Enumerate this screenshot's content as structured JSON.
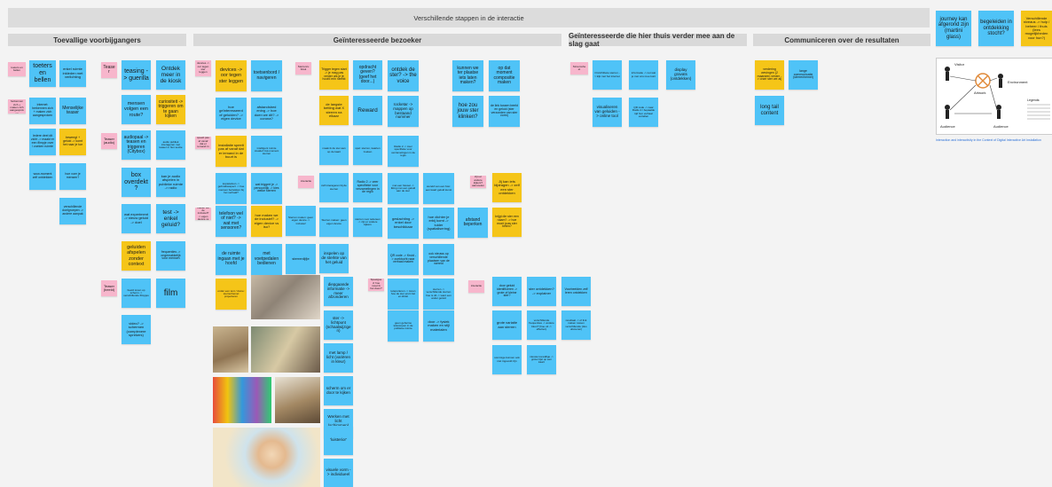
{
  "title_bar": "Verschillende stappen in de interactie",
  "headers": {
    "toevallig": "Toevallige voorbijgangers",
    "geinteresseerd": "Geïnteresseerde bezoeker",
    "thuis": "Geïnteresseerde die hier thuis verder mee aan de slag gaat",
    "communiceren": "Communiceren over de resultaten"
  },
  "notes": [
    {
      "id": "n1",
      "text": "toeters en bellen"
    },
    {
      "id": "n2",
      "text": "enkel ruimte inkleden met verlichting"
    },
    {
      "id": "n3",
      "text": "Teaser"
    },
    {
      "id": "n4",
      "text": "teasing -> guerilla"
    },
    {
      "id": "n5",
      "text": "Ontdek meer in de kiosk"
    },
    {
      "id": "n6",
      "text": "internet: herkennen zich + maken zich aangesproken"
    },
    {
      "id": "n7",
      "text": "Menselijke teaser"
    },
    {
      "id": "n8",
      "text": "mensen volgen een route?"
    },
    {
      "id": "n9",
      "text": "curiositeit -> triggeren om te gaan kijken"
    },
    {
      "id": "n10",
      "text": "Iedere deel dit zicht -> maakt er een filmpje over / zoeken ruimte"
    },
    {
      "id": "n11",
      "text": "beweegt + geluid -> komt het naar je toe"
    },
    {
      "id": "n12",
      "text": "Teaser (audio)"
    },
    {
      "id": "n13",
      "text": "audiopaal -> teasen en triggeren (Citybox)"
    },
    {
      "id": "n14",
      "text": "audio publiek interageren met teaser in hun sectie"
    },
    {
      "id": "n15",
      "text": "wow-moment zelf ontdekken"
    },
    {
      "id": "n16",
      "text": "hoe voer je mensen?"
    },
    {
      "id": "n17",
      "text": "box overdekt?"
    },
    {
      "id": "n18",
      "text": "kan je audio afspelen in publieke ruimte -> radio"
    },
    {
      "id": "n19",
      "text": "verschillende doelgroepen -> andere aanpak"
    },
    {
      "id": "n20",
      "text": "wat experiment -> nieuw geluid -> doel"
    },
    {
      "id": "n21",
      "text": "test -> enkel geluid?"
    },
    {
      "id": "n22",
      "text": "geluiden afspelen zonder context"
    },
    {
      "id": "n23",
      "text": "frequenties -> ongemakkelijk voor mensen"
    },
    {
      "id": "n24",
      "text": "Teaser (beeld)"
    },
    {
      "id": "n25",
      "text": "film"
    },
    {
      "id": "n26",
      "text": "beeld tonen op scherm -> verschillende filmpjes"
    },
    {
      "id": "n27",
      "text": "video? -> schermen (complexere sprekers)"
    },
    {
      "id": "n28",
      "text": "devices -> oor tegen ster leggen"
    },
    {
      "id": "n29",
      "text": "toetsenbord / navigeren"
    },
    {
      "id": "n30",
      "text": "Sterrenrubriek"
    },
    {
      "id": "n31",
      "text": "hoe geïnteresseerd of geluiden? -> eigen device"
    },
    {
      "id": "n32",
      "text": "afstandsbed ening -> hoe doen we dit? -> corona?"
    },
    {
      "id": "n33",
      "text": "installatie speelt pas af vanaf dat er iemand in de buurt is"
    },
    {
      "id": "n34",
      "text": "koptelefoon -> gebruiksaspect -> hoe mensen betrekken bij het verhaal?"
    },
    {
      "id": "n35",
      "text": "wat triggert je -> persoonlijk -> kies welke sterren"
    },
    {
      "id": "n36",
      "text": "telefoon wel of niet? -> wat met sensoren?"
    },
    {
      "id": "n37",
      "text": "hoe maken we de inclusief? -> eigen device vs iso?"
    },
    {
      "id": "n38",
      "text": "Sterren maken: geen eigen device -> inclusief"
    },
    {
      "id": "n39",
      "text": "de ruimte ingaan met je hoofd"
    },
    {
      "id": "n40",
      "text": "met voetpedalen bedienen"
    },
    {
      "id": "n41",
      "text": "sterrenlijfje"
    },
    {
      "id": "n42",
      "text": "onder een tent / dome: sterrenhemel projecteren"
    },
    {
      "id": "n43",
      "text": "Trigger tegen start -> je mag pas verder als je je hoofd erin steekt"
    },
    {
      "id": "n44",
      "text": "opdracht geven? (geef het door...)"
    },
    {
      "id": "n45",
      "text": "ontdek de ster? -> the voice"
    },
    {
      "id": "n46",
      "text": "kunnen we ter plaatse iets laten maken?"
    },
    {
      "id": "n47",
      "text": "op dat moment compositie maken"
    },
    {
      "id": "n48",
      "text": "de langste betting wat X sterren na elkaar"
    },
    {
      "id": "n49",
      "text": "Reward"
    },
    {
      "id": "n50",
      "text": "rocketar -> mappen op bestaand nummer"
    },
    {
      "id": "n51",
      "text": "hoe zou jouw ster klinken?"
    },
    {
      "id": "n52",
      "text": "de link tussen beeld en geluid (ster verzonden van ster vorm)"
    },
    {
      "id": "n53",
      "text": "intelligent ruimte creatief: bol-moment sterren"
    },
    {
      "id": "n54",
      "text": "maak ik de ster aan op de kaart"
    },
    {
      "id": "n55",
      "text": "spel: sterren, kaarten zoeken"
    },
    {
      "id": "n56",
      "text": "Radio 2 -> zeer specifieke voor verzamelingen in de regio"
    },
    {
      "id": "n57",
      "text": "met een fotoset -> liking met een geluid aan de ster"
    },
    {
      "id": "n58",
      "text": "wereld van een foto: een kaart geluid kunst"
    },
    {
      "id": "n59",
      "text": "interactie"
    },
    {
      "id": "n60",
      "text": "zelf interageren bij de sterren"
    },
    {
      "id": "n61",
      "text": "zijn er andere kijkers? aanvoelen"
    },
    {
      "id": "n62",
      "text": "Jij kan iets bijdragen -> zelf een ster ontdekken"
    },
    {
      "id": "n63",
      "text": "Sterren maken: geen eigen device"
    },
    {
      "id": "n64",
      "text": "sterren voor iedereen -> zijn er andere kijkers"
    },
    {
      "id": "n65",
      "text": "sterren zoeken"
    },
    {
      "id": "n66",
      "text": "gezicht: een ster kiezen en aangeven -> leren kennen"
    },
    {
      "id": "n67",
      "text": "geslachting -> enkel door beschikkaar"
    },
    {
      "id": "n68",
      "text": "hoe dichter je erbij komt -> luider (spatialisering)"
    },
    {
      "id": "n69",
      "text": "afstand beperken"
    },
    {
      "id": "n70",
      "text": "krijgt die ster een naam? -> hoe moet jouw ster heten?"
    },
    {
      "id": "n71",
      "text": "inspelen op de sterkte van het geluid"
    },
    {
      "id": "n72",
      "text": "QR code -> Kruid -> zoektocht naar verhaal maken"
    },
    {
      "id": "n73",
      "text": "ook nieuws op verschillende plaatsen van de wereld"
    },
    {
      "id": "n74",
      "text": "Speelgoed: hoe moet ik het doen?"
    },
    {
      "id": "n75",
      "text": "diepgaande informatie -> meer afzonderen"
    },
    {
      "id": "n76",
      "text": "teleporteren -> tonen hoe de ster eruit ziet en klinkt"
    },
    {
      "id": "n77",
      "text": "sterren -> verschillende sterren hoe is dit -> want een ander geluid"
    },
    {
      "id": "n78",
      "text": "ster -> lichtpunt (schaalwijzigen)"
    },
    {
      "id": "n79",
      "text": "met lamp / licht (variëren in kleur)"
    },
    {
      "id": "n80",
      "text": "geen geheime telescopen in de publieke ruimte"
    },
    {
      "id": "n81",
      "text": "door -> fysiek maken en stijl materialen"
    },
    {
      "id": "n82",
      "text": "scherm om er door te kijken"
    },
    {
      "id": "n83",
      "text": "Werken met licht (schimmen) link ster"
    },
    {
      "id": "n84",
      "text": "'luisterior'"
    },
    {
      "id": "n85",
      "text": "visuele vorm -> individueel"
    },
    {
      "id": "n86",
      "text": "Sterren zoeken"
    },
    {
      "id": "n87",
      "text": "Stroomsheet"
    },
    {
      "id": "n88",
      "text": "Onzichtbare sterren -> kijk met het internet"
    },
    {
      "id": "n89",
      "text": "informatie -> net wat je met ons mee kunt"
    },
    {
      "id": "n90",
      "text": "visualiseren van geluiden -> online tool"
    },
    {
      "id": "n91",
      "text": "QR code -> naar Radio 2 / bepaalde tijd hun verhaal vertellen"
    },
    {
      "id": "n92",
      "text": "display gravats (ontdekken)"
    },
    {
      "id": "n93",
      "text": "visualiseren van geluiden / beeldschermen voor de kiosk"
    },
    {
      "id": "n94",
      "text": "door geluid identificeren -> grote of kleine ster?"
    },
    {
      "id": "n95",
      "text": "ster ontdekken? -> explainer"
    },
    {
      "id": "n96",
      "text": "Voorbeelden zelf leren ontdekken"
    },
    {
      "id": "n97",
      "text": "grote variatie aan sterren"
    },
    {
      "id": "n98",
      "text": "verschillende frequenties -> andere kleur? (hoe uit -> effecten)"
    },
    {
      "id": "n99",
      "text": "resultaat -> of link maken tussen verschillende (dus uitvoeren)"
    },
    {
      "id": "n100",
      "text": "sommige kunnen ook niet ingevuld zijn"
    },
    {
      "id": "n101",
      "text": "nieuwe toevallige -> groter lijst op een kaart"
    },
    {
      "id": "n102",
      "text": "verdering wevingen (2 maanden verder -> onze ster we al)"
    },
    {
      "id": "n103",
      "text": "lange communicatie (sterrenhemel)"
    },
    {
      "id": "n104",
      "text": "long tail content"
    },
    {
      "id": "n105",
      "text": "journey kan afgerond zijn (martini glass)"
    },
    {
      "id": "n106",
      "text": "begeleiden in ontdekking stocht?"
    },
    {
      "id": "n107",
      "text": "Verschillende niveaus -> hulp / beheer / thuis (lees mogelijkheden voor hun?)"
    },
    {
      "id": "n108",
      "text": "Teaser"
    }
  ],
  "diagram": {
    "labels": {
      "visitor": "Visitor",
      "artwork": "Artwork",
      "environment": "Environment",
      "audience": "Audience",
      "legends": "Legends:"
    },
    "caption": "Interaction and interactivity in the Context of Digital Interactive Art Installation"
  },
  "colors": {
    "blue": "#4fc3f7",
    "yellow": "#f5c518",
    "pink": "#f7b6cc",
    "bar": "#d9d9d9"
  }
}
